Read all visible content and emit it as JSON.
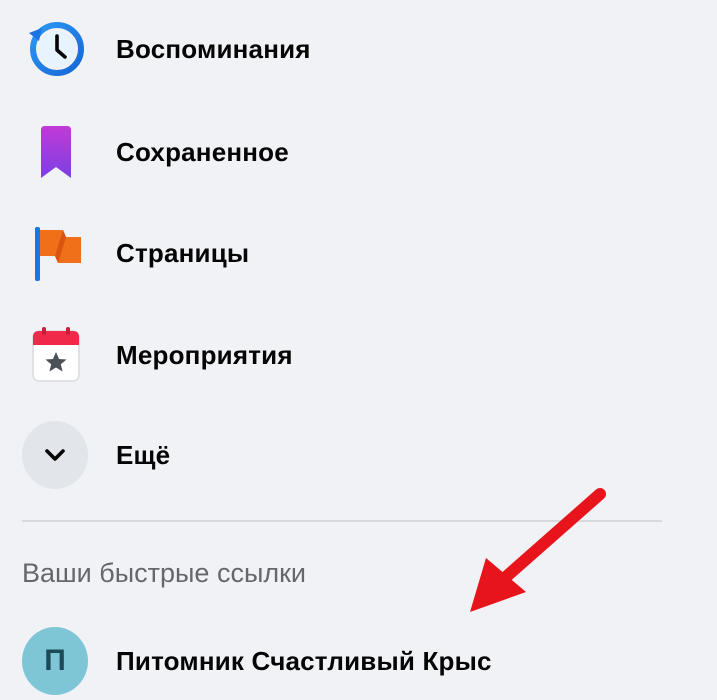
{
  "menu": {
    "items": [
      {
        "label": "Воспоминания",
        "icon": "memories-clock-icon"
      },
      {
        "label": "Сохраненное",
        "icon": "saved-bookmark-icon"
      },
      {
        "label": "Страницы",
        "icon": "pages-flag-icon"
      },
      {
        "label": "Мероприятия",
        "icon": "events-calendar-icon"
      },
      {
        "label": "Ещё",
        "icon": "chevron-down-icon"
      }
    ]
  },
  "shortcuts": {
    "title": "Ваши быстрые ссылки",
    "items": [
      {
        "label": "Питомник Счастливый Крыс",
        "avatar_letter": "П"
      }
    ]
  },
  "colors": {
    "background": "#f0f2f5",
    "accent_blue": "#1b74e4",
    "annotation_arrow": "#e8141b",
    "avatar": "#7ec6d6"
  }
}
